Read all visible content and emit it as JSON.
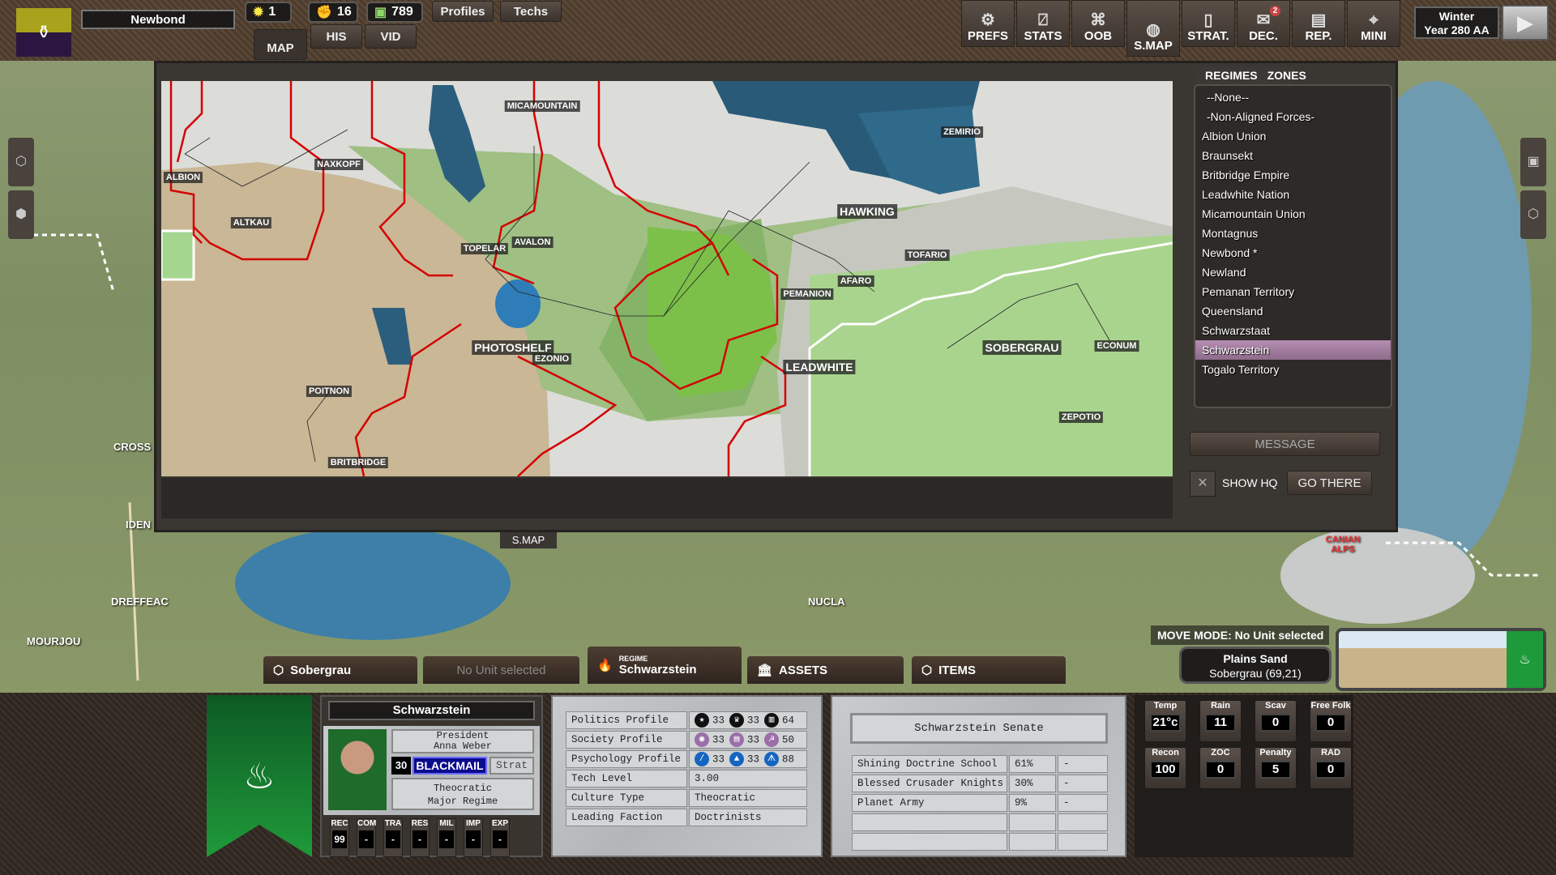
{
  "header": {
    "regime_name": "Newbond",
    "resources": [
      {
        "icon": "sun-icon",
        "value": "1"
      },
      {
        "icon": "fist-icon",
        "value": "16"
      },
      {
        "icon": "money-icon",
        "value": "789"
      }
    ],
    "profiles_label": "Profiles",
    "techs_label": "Techs",
    "tabs": [
      "MAP",
      "HIS",
      "VID"
    ],
    "toolbar": [
      {
        "label": "PREFS",
        "icon": "gear-icon"
      },
      {
        "label": "STATS",
        "icon": "chart-icon"
      },
      {
        "label": "OOB",
        "icon": "hierarchy-icon"
      },
      {
        "label": "S.MAP",
        "icon": "globe-icon"
      },
      {
        "label": "STRAT.",
        "icon": "cards-icon"
      },
      {
        "label": "DEC.",
        "icon": "mail-icon",
        "badge": "2"
      },
      {
        "label": "REP.",
        "icon": "report-icon"
      },
      {
        "label": "MINI",
        "icon": "map-pin-icon"
      }
    ],
    "season": "Winter",
    "year": "Year 280 AA"
  },
  "world_labels": [
    "CROSS",
    "IDEN",
    "DREFFEAC",
    "MOURJOU",
    "NUCLA",
    "CANIAN ALPS"
  ],
  "strategic_map": {
    "tab_label": "S.MAP",
    "cities": [
      "ALBION",
      "NAXKOPF",
      "ALTKAU",
      "MICAMOUNTAIN",
      "TOPELAR",
      "AVALON",
      "PHOTOSHELF",
      "EZONIO",
      "POITNON",
      "BRITBRIDGE",
      "ZEMIRIO",
      "HAWKING",
      "TOFARIO",
      "AFARO",
      "PEMANION",
      "LEADWHITE",
      "SOBERGRAU",
      "ECONUM",
      "ZEPOTIO"
    ],
    "panel_tabs": [
      "REGIMES",
      "ZONES"
    ],
    "regimes": [
      "--None--",
      "-Non-Aligned Forces-",
      "Albion Union",
      "Braunsekt",
      "Britbridge Empire",
      "Leadwhite Nation",
      "Micamountain Union",
      "Montagnus",
      "Newbond *",
      "Newland",
      "Pemanan Territory",
      "Queensland",
      "Schwarzstaat",
      "Schwarzstein",
      "Togalo Territory"
    ],
    "selected_regime": "Schwarzstein",
    "message_label": "MESSAGE",
    "show_hq_label": "SHOW HQ",
    "show_hq_checked": true,
    "go_there_label": "GO THERE"
  },
  "bottom_tabs": {
    "hex": "Sobergrau",
    "unit": "No Unit selected",
    "regime_caption": "REGIME",
    "regime": "Schwarzstein",
    "assets": "ASSETS",
    "items": "ITEMS"
  },
  "move_mode": "MOVE MODE: No Unit selected",
  "terrain": {
    "name": "Plains Sand",
    "location": "Sobergrau (69,21)"
  },
  "leader": {
    "regime": "Schwarzstein",
    "title": "President",
    "name": "Anna Weber",
    "level": "30",
    "trait": "BLACKMAIL",
    "mode": "Strat",
    "culture": "Theocratic",
    "status": "Major Regime",
    "stats": [
      {
        "k": "REC",
        "v": "99"
      },
      {
        "k": "COM",
        "v": "-"
      },
      {
        "k": "TRA",
        "v": "-"
      },
      {
        "k": "RES",
        "v": "-"
      },
      {
        "k": "MIL",
        "v": "-"
      },
      {
        "k": "IMP",
        "v": "-"
      },
      {
        "k": "EXP",
        "v": "-"
      }
    ]
  },
  "profile": {
    "rows": [
      {
        "label": "Politics Profile",
        "icons": [
          {
            "icon": "star-icon",
            "v": "33"
          },
          {
            "icon": "crown-icon",
            "v": "33"
          },
          {
            "icon": "pillar-icon",
            "v": "64"
          }
        ]
      },
      {
        "label": "Society Profile",
        "icons": [
          {
            "icon": "eye-icon",
            "v": "33"
          },
          {
            "icon": "cans-icon",
            "v": "33"
          },
          {
            "icon": "hammer-sickle-icon",
            "v": "50"
          }
        ]
      },
      {
        "label": "Psychology Profile",
        "icons": [
          {
            "icon": "baton-icon",
            "v": "33"
          },
          {
            "icon": "graduation-cap-icon",
            "v": "33"
          },
          {
            "icon": "people-icon",
            "v": "88"
          }
        ]
      },
      {
        "label": "Tech Level",
        "value": "3.00"
      },
      {
        "label": "Culture Type",
        "value": "Theocratic"
      },
      {
        "label": "Leading Faction",
        "value": "Doctrinists"
      }
    ],
    "colors": {
      "politics": "#111111",
      "society": "#9a6fa8",
      "psychology": "#1565c0"
    }
  },
  "senate": {
    "title": "Schwarzstein Senate",
    "rows": [
      {
        "name": "Shining Doctrine School",
        "pct": "61%",
        "x": "-"
      },
      {
        "name": "Blessed Crusader Knights",
        "pct": "30%",
        "x": "-"
      },
      {
        "name": "Planet Army",
        "pct": "9%",
        "x": "-"
      }
    ]
  },
  "hex_stats": [
    {
      "k": "Temp",
      "v": "21°c"
    },
    {
      "k": "Rain",
      "v": "11"
    },
    {
      "k": "Scav",
      "v": "0"
    },
    {
      "k": "Free Folk",
      "v": "0"
    },
    {
      "k": "Recon",
      "v": "100"
    },
    {
      "k": "ZOC",
      "v": "0"
    },
    {
      "k": "Penalty",
      "v": "5"
    },
    {
      "k": "RAD",
      "v": "0"
    }
  ],
  "colors": {
    "newbond_flag_top": "#a9a21c",
    "newbond_flag_bottom": "#2a1640",
    "schwarzstein_flag": "#1f9a3a",
    "selected_row": "#a67fa3",
    "border_red": "#d40000"
  }
}
